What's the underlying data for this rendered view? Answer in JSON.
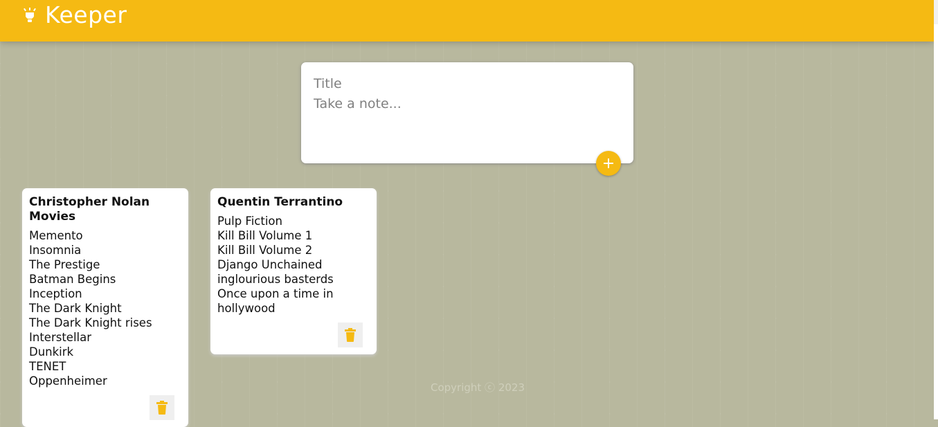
{
  "header": {
    "title": "Keeper",
    "icon": "lightbulb-icon",
    "color": "#f5ba13"
  },
  "create_note": {
    "title_placeholder": "Title",
    "title_value": "",
    "content_placeholder": "Take a note...",
    "content_value": "",
    "add_icon": "plus-icon"
  },
  "notes": [
    {
      "title": "Christopher Nolan Movies",
      "lines": [
        "Memento",
        "Insomnia",
        "The Prestige",
        "Batman Begins",
        "Inception",
        "The Dark Knight",
        "The Dark Knight rises",
        "Interstellar",
        "Dunkirk",
        "TENET",
        "Oppenheimer"
      ],
      "delete_icon": "trash-icon"
    },
    {
      "title": "Quentin Terrantino",
      "lines": [
        "Pulp Fiction",
        "Kill Bill Volume 1",
        "Kill Bill Volume 2",
        "Django Unchained",
        "inglourious basterds",
        "Once upon a time in hollywood"
      ],
      "delete_icon": "trash-icon"
    }
  ],
  "footer": {
    "text": "Copyright ⓒ 2023"
  },
  "colors": {
    "accent": "#f5ba13",
    "background": "#b8b89e",
    "card": "#ffffff"
  }
}
